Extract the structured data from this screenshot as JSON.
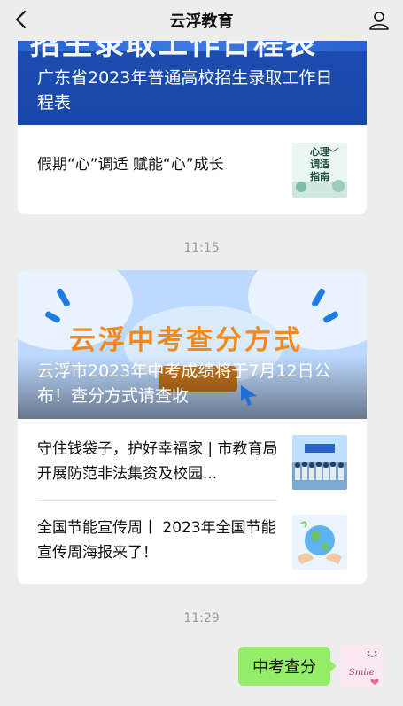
{
  "header": {
    "title": "云浮教育",
    "back_icon": "chevron-left-icon",
    "profile_icon": "person-icon"
  },
  "card1": {
    "cover_banner_text": "招生录取工作日程表",
    "cover_title": "广东省2023年普通高校招生录取工作日程表",
    "items": [
      {
        "text": "假期“心”调适 赋能“心”成长",
        "thumb_text": "心理\n调适\n指南"
      }
    ]
  },
  "time1": "11:15",
  "card2": {
    "cover_big_text": "云浮中考查分方式",
    "cover_title": "云浮市2023年中考成绩将于7月12日公布！查分方式请查收",
    "items": [
      {
        "text": "守住钱袋子，护好幸福家 | 市教育局开展防范非法集资及校园..."
      },
      {
        "text": "全国节能宣传周丨 2023年全国节能宣传周海报来了！"
      }
    ]
  },
  "time2": "11:29",
  "message": {
    "text": "中考查分",
    "avatar_text": "Smile"
  },
  "colors": {
    "background": "#ededed",
    "bubble": "#95ec69",
    "cover1_blue": "#1d4fb0",
    "cover2_orange": "#f08a1e"
  }
}
